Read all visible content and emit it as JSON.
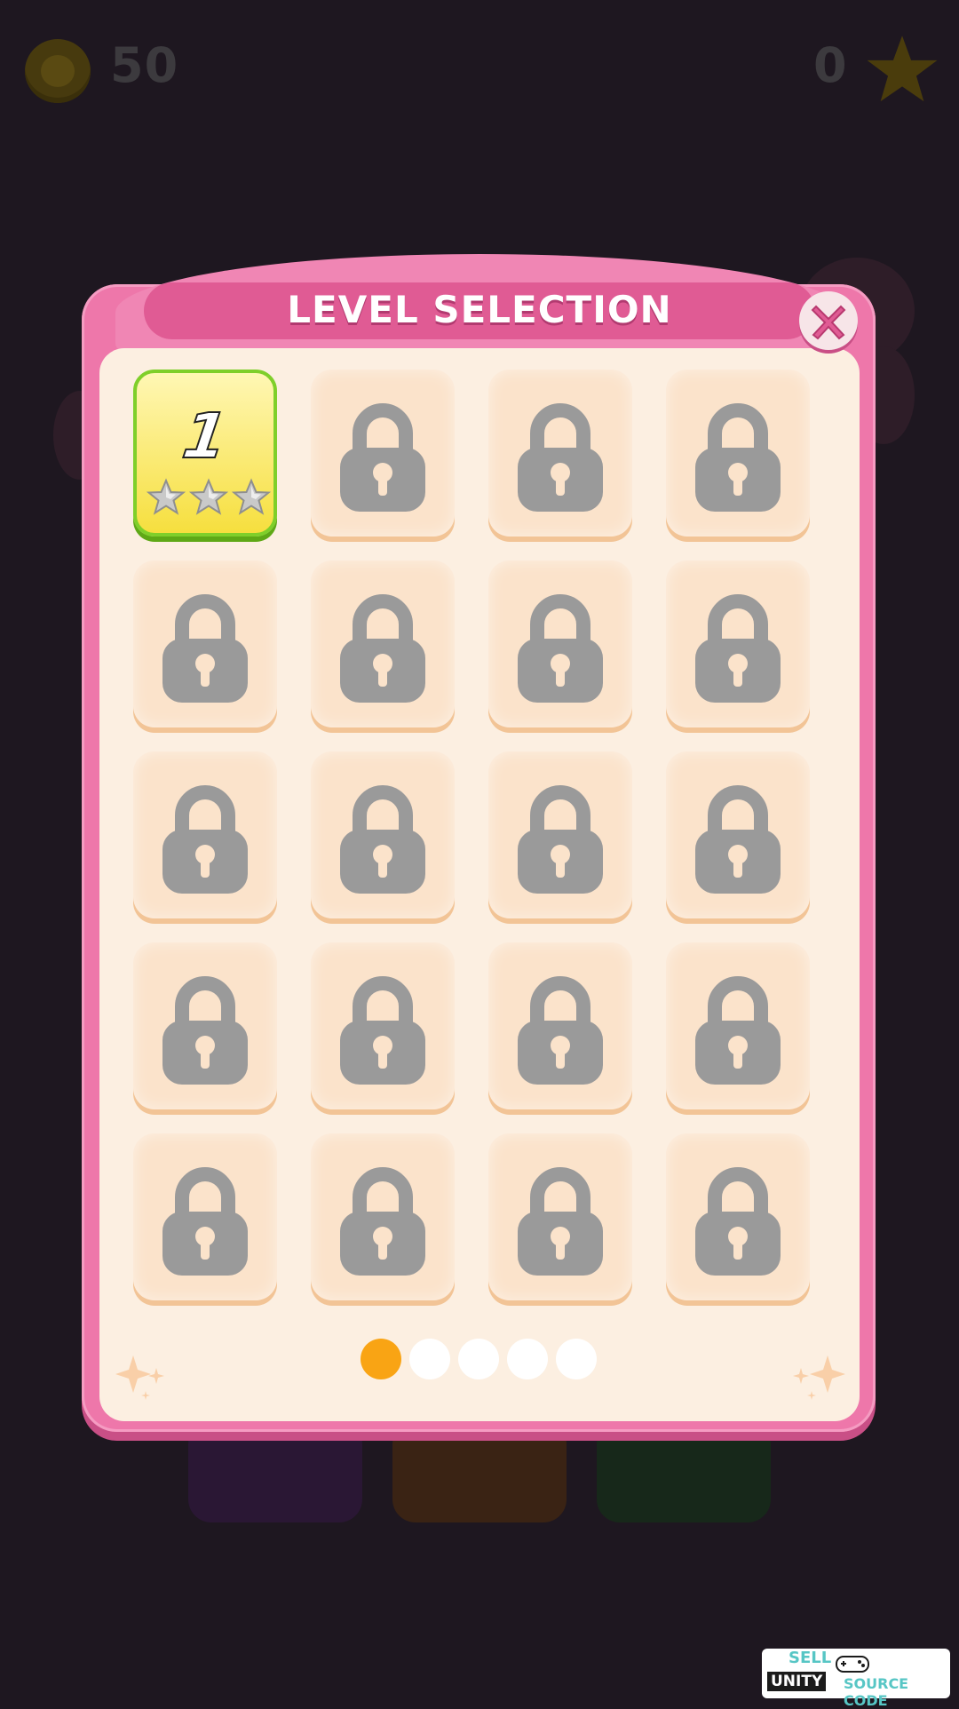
{
  "hud": {
    "coin_count": "50",
    "star_count": "0"
  },
  "dialog": {
    "title": "LEVEL SELECTION",
    "close_icon": "close-x-icon"
  },
  "levels": [
    {
      "label": "1",
      "locked": false,
      "stars": 0,
      "max_stars": 3
    },
    {
      "locked": true
    },
    {
      "locked": true
    },
    {
      "locked": true
    },
    {
      "locked": true
    },
    {
      "locked": true
    },
    {
      "locked": true
    },
    {
      "locked": true
    },
    {
      "locked": true
    },
    {
      "locked": true
    },
    {
      "locked": true
    },
    {
      "locked": true
    },
    {
      "locked": true
    },
    {
      "locked": true
    },
    {
      "locked": true
    },
    {
      "locked": true
    },
    {
      "locked": true
    },
    {
      "locked": true
    },
    {
      "locked": true
    },
    {
      "locked": true
    }
  ],
  "pagination": {
    "pages": 5,
    "current": 1
  },
  "watermark": {
    "sell": "SELL",
    "unity": "UNITY",
    "source": "SOURCE CODE"
  },
  "colors": {
    "panel_pink": "#ee77aa",
    "title_bar": "#e05b94",
    "tile_bg": "#fbe3cb",
    "unlocked_tile": "#f6df3e",
    "lock_gray": "#9a9a9a",
    "active_dot": "#f9a414"
  }
}
